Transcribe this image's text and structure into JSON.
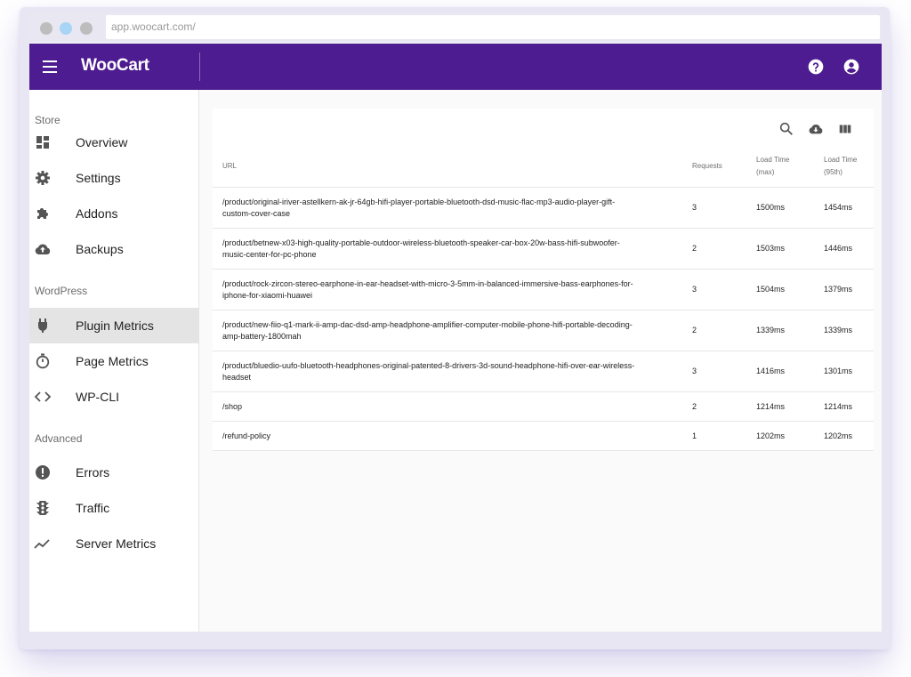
{
  "browser": {
    "url": "app.woocart.com/"
  },
  "appbar": {
    "logo": "WooCart"
  },
  "sidebar": {
    "sections": [
      {
        "title": "Store",
        "items": [
          {
            "label": "Overview",
            "icon": "dashboard-icon"
          },
          {
            "label": "Settings",
            "icon": "gear-icon"
          },
          {
            "label": "Addons",
            "icon": "puzzle-icon"
          },
          {
            "label": "Backups",
            "icon": "cloud-upload-icon"
          }
        ]
      },
      {
        "title": "WordPress",
        "items": [
          {
            "label": "Plugin Metrics",
            "icon": "plug-icon",
            "active": true
          },
          {
            "label": "Page Metrics",
            "icon": "timer-icon"
          },
          {
            "label": "WP-CLI",
            "icon": "code-icon"
          }
        ]
      },
      {
        "title": "Advanced",
        "items": [
          {
            "label": "Errors",
            "icon": "alert-icon"
          },
          {
            "label": "Traffic",
            "icon": "traffic-light-icon"
          },
          {
            "label": "Server Metrics",
            "icon": "trend-icon"
          }
        ]
      }
    ]
  },
  "toolbar": {
    "icons": [
      "search-icon",
      "cloud-download-icon",
      "columns-icon"
    ]
  },
  "table": {
    "columns": [
      {
        "label": "URL",
        "sub": ""
      },
      {
        "label": "Requests",
        "sub": ""
      },
      {
        "label": "Load Time",
        "sub": "(max)"
      },
      {
        "label": "Load Time",
        "sub": "(95th)"
      }
    ],
    "rows": [
      {
        "url_line1": "/product/original-iriver-astellkern-ak-jr-64gb-hifi-player-portable-bluetooth-dsd-music-flac-mp3-audio-player-gift-",
        "url_line2": "custom-cover-case",
        "requests": "3",
        "max": "1500ms",
        "p95": "1454ms"
      },
      {
        "url_line1": "/product/betnew-x03-high-quality-portable-outdoor-wireless-bluetooth-speaker-car-box-20w-bass-hifi-subwoofer-",
        "url_line2": "music-center-for-pc-phone",
        "requests": "2",
        "max": "1503ms",
        "p95": "1446ms"
      },
      {
        "url_line1": "/product/rock-zircon-stereo-earphone-in-ear-headset-with-micro-3-5mm-in-balanced-immersive-bass-earphones-for-",
        "url_line2": "iphone-for-xiaomi-huawei",
        "requests": "3",
        "max": "1504ms",
        "p95": "1379ms"
      },
      {
        "url_line1": "/product/new-fiio-q1-mark-ii-amp-dac-dsd-amp-headphone-amplifier-computer-mobile-phone-hifi-portable-decoding-",
        "url_line2": "amp-battery-1800mah",
        "requests": "2",
        "max": "1339ms",
        "p95": "1339ms"
      },
      {
        "url_line1": "/product/bluedio-uufo-bluetooth-headphones-original-patented-8-drivers-3d-sound-headphone-hifi-over-ear-wireless-",
        "url_line2": "headset",
        "requests": "3",
        "max": "1416ms",
        "p95": "1301ms"
      },
      {
        "url_line1": "/shop",
        "url_line2": "",
        "requests": "2",
        "max": "1214ms",
        "p95": "1214ms"
      },
      {
        "url_line1": "/refund-policy",
        "url_line2": "",
        "requests": "1",
        "max": "1202ms",
        "p95": "1202ms"
      }
    ]
  },
  "colors": {
    "appbar": "#4e1c91",
    "sidebar_active": "#e4e4e4",
    "icon": "#555555"
  }
}
